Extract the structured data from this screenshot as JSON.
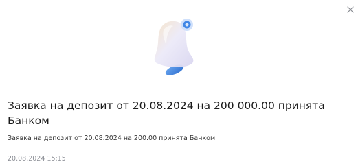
{
  "notification": {
    "title": "Заявка на депозит от 20.08.2024 на 200 000.00 принята Банком",
    "body": "Заявка на депозит от 20.08.2024 на 200.00 принята Банком",
    "timestamp": "20.08.2024 15:15",
    "icon": "bell-icon",
    "close_icon": "close-icon"
  },
  "colors": {
    "bell_body": "#e8e6f6",
    "bell_shade": "#f3d7b7",
    "bell_clapper": "#4a8de0",
    "title_text": "#1a1a1a",
    "timestamp_text": "#8c8f96"
  }
}
